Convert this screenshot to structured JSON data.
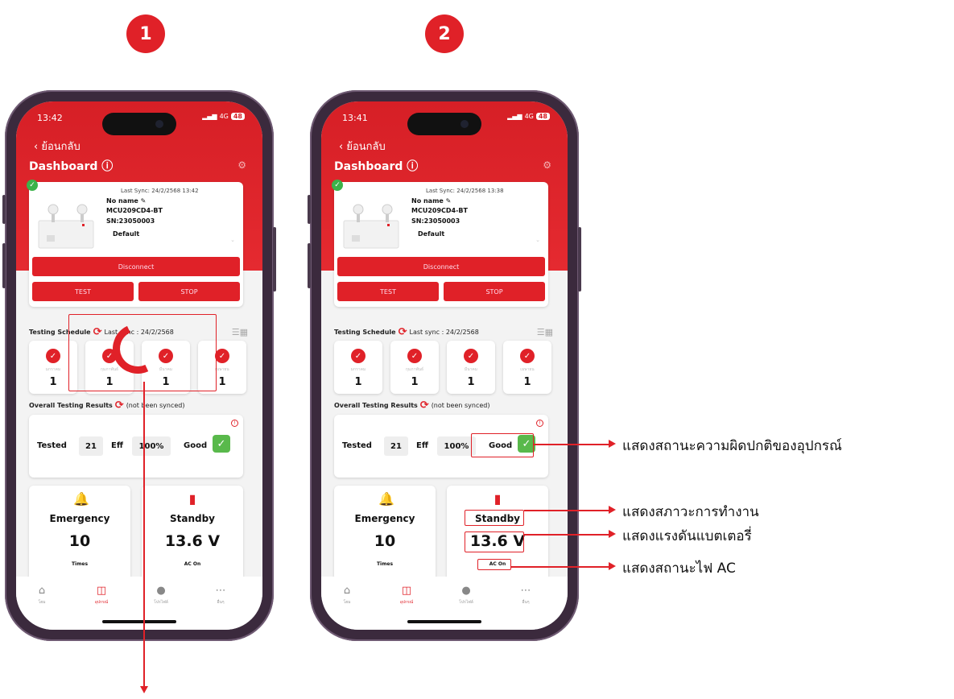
{
  "steps": [
    "1",
    "2"
  ],
  "phones": [
    {
      "time": "13:42",
      "signal": "4G",
      "battery": "48",
      "back_label": "ย้อนกลับ",
      "title": "Dashboard",
      "title_icon": "info-icon",
      "last_sync": "Last Sync: 24/2/2568 13:42",
      "device_name": "No name",
      "device_model": "MCU209CD4-BT",
      "serial": "SN:23050003",
      "mode": "Default",
      "disconnect_label": "Disconnect",
      "test_label": "TEST",
      "stop_label": "STOP",
      "schedule_title": "Testing Schedule",
      "schedule_sync": "Last sync : 24/2/2568",
      "schedule": [
        {
          "month": "มกราคม",
          "count": "1"
        },
        {
          "month": "กุมภาพันธ์",
          "count": "1"
        },
        {
          "month": "มีนาคม",
          "count": "1"
        },
        {
          "month": "เมษายน",
          "count": "1"
        }
      ],
      "results_title": "Overall Testing Results",
      "results_note": "(not been synced)",
      "tested_label": "Tested",
      "tested_value": "21",
      "eff_label": "Eff",
      "eff_value": "100%",
      "good_label": "Good",
      "emergency_title": "Emergency",
      "emergency_value": "10",
      "emergency_unit": "Times",
      "standby_title": "Standby",
      "standby_value": "13.6 V",
      "ac_status": "AC On",
      "tabs": [
        "โฮม",
        "อุปกรณ์",
        "โปรไฟล์",
        "อื่นๆ"
      ]
    },
    {
      "time": "13:41",
      "signal": "4G",
      "battery": "48",
      "back_label": "ย้อนกลับ",
      "title": "Dashboard",
      "title_icon": "info-icon",
      "last_sync": "Last Sync: 24/2/2568 13:38",
      "device_name": "No name",
      "device_model": "MCU209CD4-BT",
      "serial": "SN:23050003",
      "mode": "Default",
      "disconnect_label": "Disconnect",
      "test_label": "TEST",
      "stop_label": "STOP",
      "schedule_title": "Testing Schedule",
      "schedule_sync": "Last sync : 24/2/2568",
      "schedule": [
        {
          "month": "มกราคม",
          "count": "1"
        },
        {
          "month": "กุมภาพันธ์",
          "count": "1"
        },
        {
          "month": "มีนาคม",
          "count": "1"
        },
        {
          "month": "เมษายน",
          "count": "1"
        }
      ],
      "results_title": "Overall Testing Results",
      "results_note": "(not been synced)",
      "tested_label": "Tested",
      "tested_value": "21",
      "eff_label": "Eff",
      "eff_value": "100%",
      "good_label": "Good",
      "emergency_title": "Emergency",
      "emergency_value": "10",
      "emergency_unit": "Times",
      "standby_title": "Standby",
      "standby_value": "13.6 V",
      "ac_status": "AC On",
      "tabs": [
        "โฮม",
        "อุปกรณ์",
        "โปรไฟล์",
        "อื่นๆ"
      ]
    }
  ],
  "annotations": [
    "แสดงสถานะความผิดปกติของอุปกรณ์",
    "แสดงสภาวะการทำงาน",
    "แสดงแรงดันแบตเตอรี่",
    "แสดงสถานะไฟ AC"
  ],
  "colors": {
    "accent": "#e02128",
    "good": "#59b94b",
    "online": "#3bb34a"
  }
}
